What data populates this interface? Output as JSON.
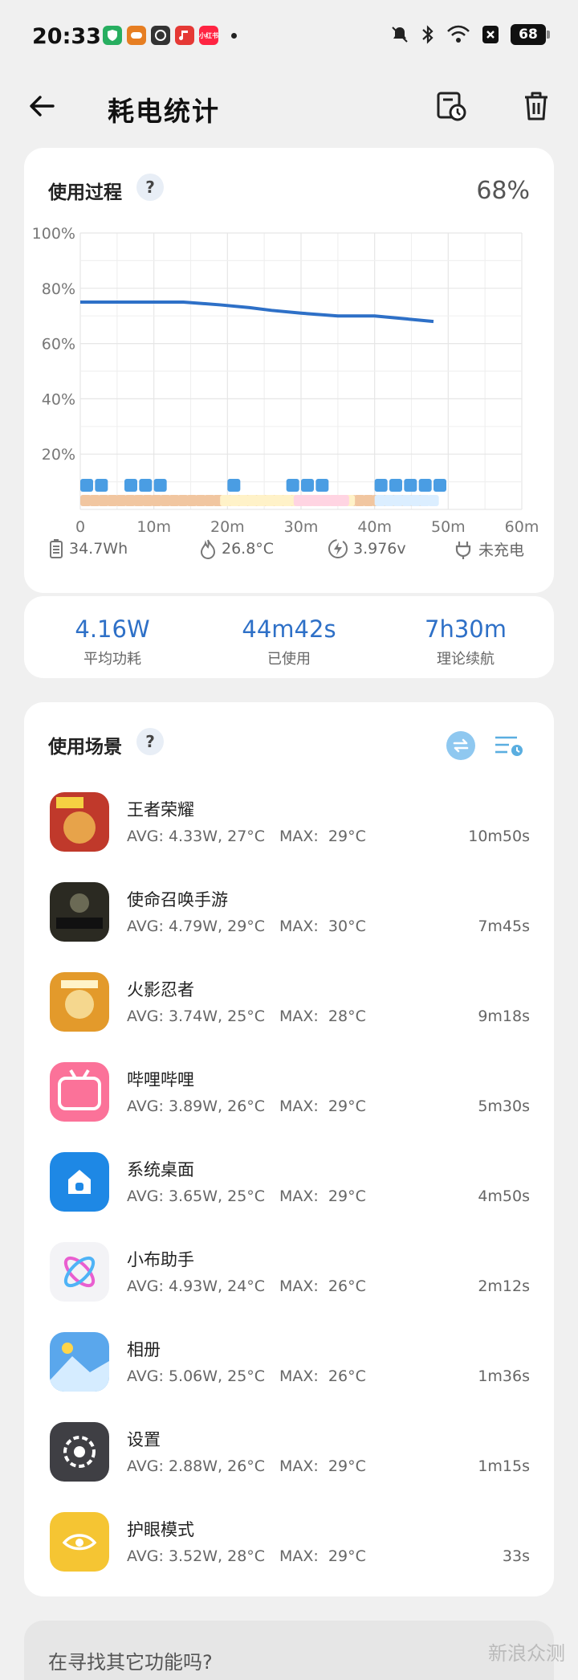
{
  "status_bar": {
    "time": "20:33",
    "battery": "68",
    "app_badge": "小红书",
    "icons": [
      "shield-icon",
      "game-icon",
      "app-icon",
      "music-icon",
      "xiaohongshu-icon",
      "mute-icon",
      "bluetooth-icon",
      "wifi-icon",
      "close-box-icon",
      "battery-icon"
    ]
  },
  "header": {
    "title": "耗电统计",
    "icons": [
      "back-arrow-icon",
      "history-icon",
      "trash-icon"
    ]
  },
  "usage_process": {
    "title": "使用过程",
    "help": "?",
    "battery_percent": "68%",
    "stats": {
      "capacity": "34.7Wh",
      "temperature": "26.8°C",
      "voltage": "3.976v",
      "charging": "未充电"
    }
  },
  "chart_data": {
    "type": "line",
    "x_tick_labels": [
      "0",
      "10m",
      "20m",
      "30m",
      "40m",
      "50m",
      "60m"
    ],
    "y_tick_labels": [
      "100%",
      "80%",
      "60%",
      "40%",
      "20%"
    ],
    "xlim": [
      0,
      60
    ],
    "ylim": [
      0,
      100
    ],
    "grid": true,
    "series": [
      {
        "x": [
          0,
          14,
          19,
          23,
          26,
          30,
          35,
          40,
          44,
          48
        ],
        "y": [
          75,
          75,
          74,
          73,
          72,
          71,
          70,
          70,
          69,
          68
        ]
      }
    ]
  },
  "summary": {
    "avg_power_value": "4.16W",
    "avg_power_label": "平均功耗",
    "used_value": "44m42s",
    "used_label": "已使用",
    "estimate_value": "7h30m",
    "estimate_label": "理论续航"
  },
  "scenes": {
    "title": "使用场景",
    "help": "?",
    "max_label": "MAX:",
    "apps": [
      {
        "name": "王者荣耀",
        "avg": "AVG: 4.33W, 27°C",
        "max": "29°C",
        "duration": "10m50s",
        "icon": "honor-of-kings-icon",
        "color": "#c0392b",
        "badge": "5v5"
      },
      {
        "name": "使命召唤手游",
        "avg": "AVG: 4.79W, 29°C",
        "max": "30°C",
        "duration": "7m45s",
        "icon": "call-of-duty-icon",
        "color": "#2b2a22",
        "badge": "CALL of DUTY"
      },
      {
        "name": "火影忍者",
        "avg": "AVG: 3.74W, 25°C",
        "max": "28°C",
        "duration": "9m18s",
        "icon": "naruto-icon",
        "color": "#e39a2b",
        "badge": ""
      },
      {
        "name": "哔哩哔哩",
        "avg": "AVG: 3.89W, 26°C",
        "max": "29°C",
        "duration": "5m30s",
        "icon": "bilibili-icon",
        "color": "#fb7299",
        "badge": "bilibili"
      },
      {
        "name": "系统桌面",
        "avg": "AVG: 3.65W, 25°C",
        "max": "29°C",
        "duration": "4m50s",
        "icon": "home-icon",
        "color": "#1e88e5",
        "badge": ""
      },
      {
        "name": "小布助手",
        "avg": "AVG: 4.93W, 24°C",
        "max": "26°C",
        "duration": "2m12s",
        "icon": "assistant-icon",
        "color": "#f3f3f6",
        "badge": ""
      },
      {
        "name": "相册",
        "avg": "AVG: 5.06W, 25°C",
        "max": "26°C",
        "duration": "1m36s",
        "icon": "photos-icon",
        "color": "#5aa7ec",
        "badge": ""
      },
      {
        "name": "设置",
        "avg": "AVG: 2.88W, 26°C",
        "max": "29°C",
        "duration": "1m15s",
        "icon": "settings-gear-icon",
        "color": "#3f3f44",
        "badge": ""
      },
      {
        "name": "护眼模式",
        "avg": "AVG: 3.52W, 28°C",
        "max": "29°C",
        "duration": "33s",
        "icon": "eye-care-icon",
        "color": "#f5c533",
        "badge": ""
      }
    ]
  },
  "footer": {
    "find_text": "在寻找其它功能吗?",
    "watermark": "新浪众测"
  },
  "colors": {
    "accent": "#2e70c7",
    "line": "#2e70c7",
    "card": "#ffffff",
    "background": "#f0f0f0"
  }
}
